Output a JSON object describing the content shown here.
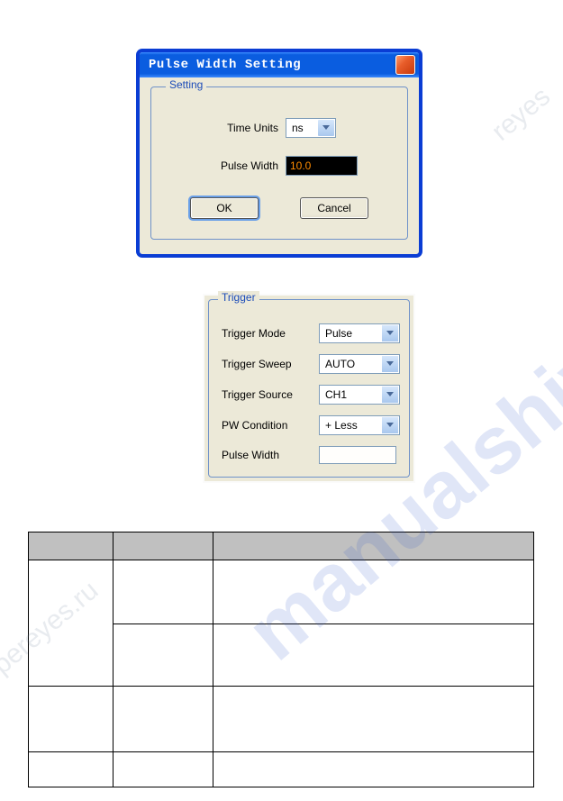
{
  "dialog": {
    "title": "Pulse Width Setting",
    "fieldset_legend": "Setting",
    "time_units_label": "Time Units",
    "time_units_value": "ns",
    "pulse_width_label": "Pulse Width",
    "pulse_width_value": "10.0",
    "ok_label": "OK",
    "cancel_label": "Cancel"
  },
  "trigger": {
    "legend": "Trigger",
    "rows": [
      {
        "label": "Trigger Mode",
        "value": "Pulse"
      },
      {
        "label": "Trigger Sweep",
        "value": "AUTO"
      },
      {
        "label": "Trigger Source",
        "value": "CH1"
      },
      {
        "label": "PW Condition",
        "value": "+ Less"
      },
      {
        "label": "Pulse Width",
        "value": ""
      }
    ]
  },
  "watermark": {
    "main": "manualshive.com",
    "small1": "pereyes.ru",
    "small2": "reyes"
  }
}
